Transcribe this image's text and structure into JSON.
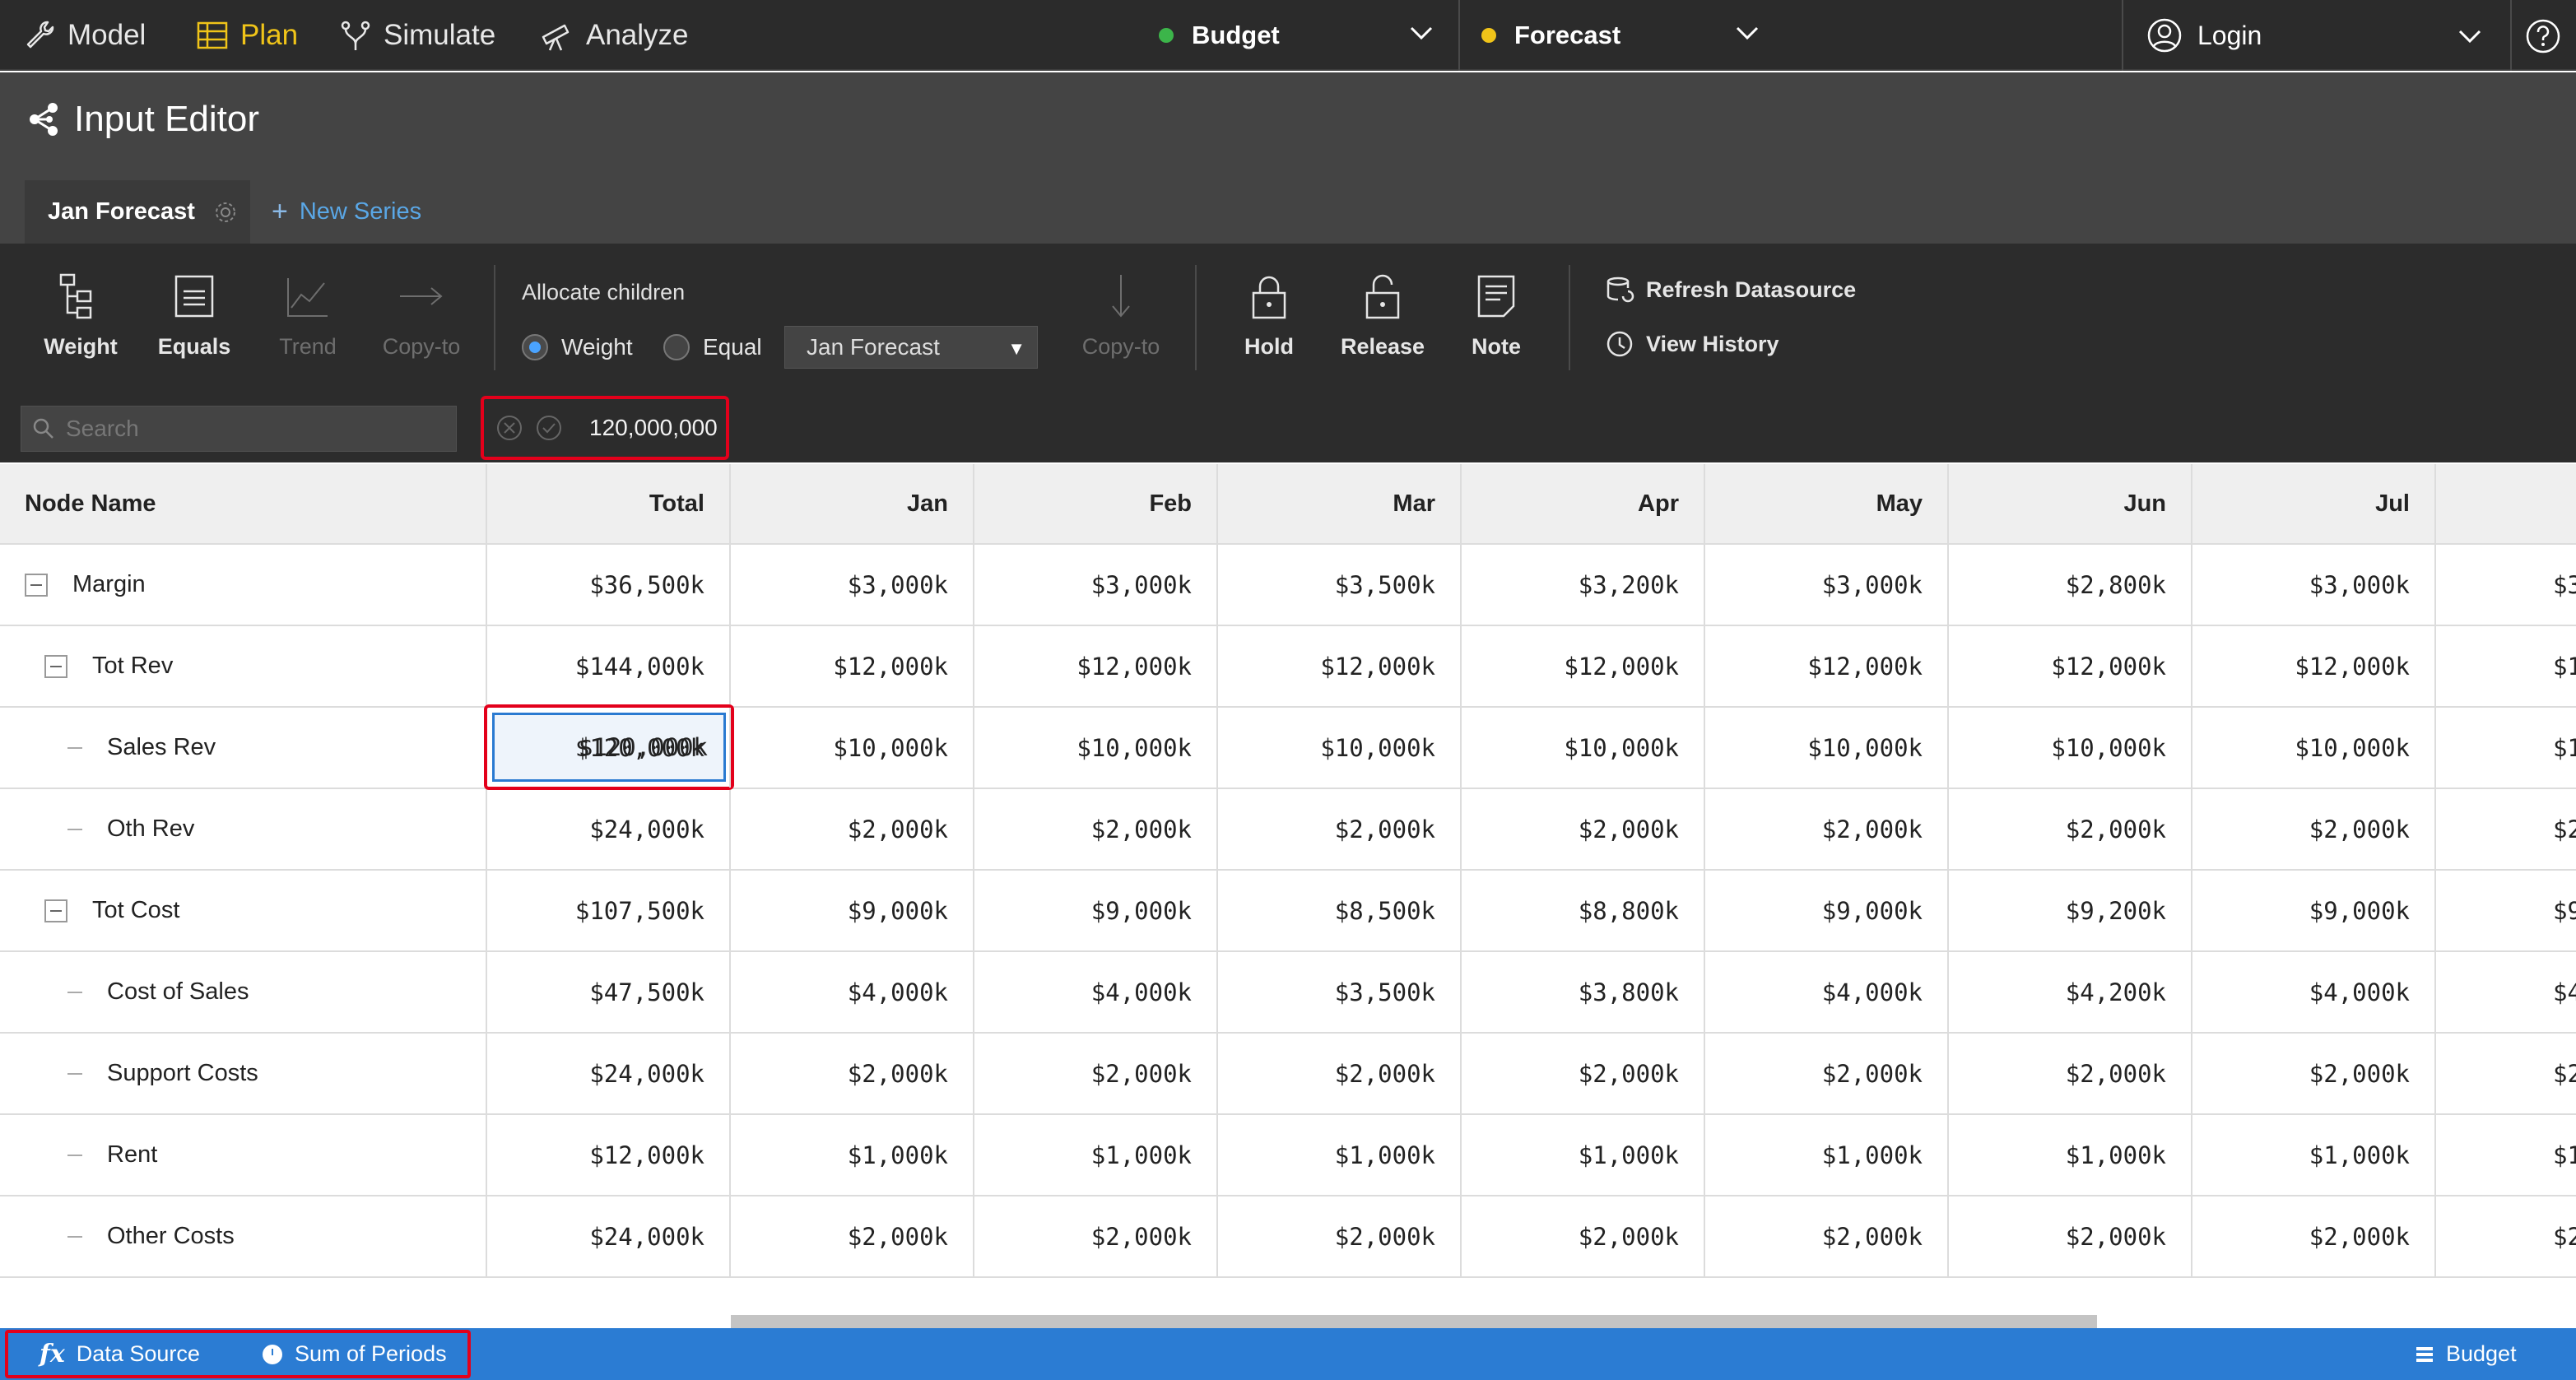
{
  "nav": {
    "items": [
      {
        "label": "Model",
        "icon": "wrench-icon"
      },
      {
        "label": "Plan",
        "icon": "table-icon",
        "active": true
      },
      {
        "label": "Simulate",
        "icon": "fork-icon"
      },
      {
        "label": "Analyze",
        "icon": "telescope-icon"
      }
    ],
    "budget_label": "Budget",
    "budget_color": "#3cb54a",
    "forecast_label": "Forecast",
    "forecast_color": "#f0c419",
    "login_label": "Login",
    "accent_color": "#f0c419"
  },
  "editor": {
    "title": "Input Editor",
    "active_tab": "Jan Forecast",
    "new_tab": "New Series"
  },
  "toolbar": {
    "weight": "Weight",
    "equals": "Equals",
    "trend": "Trend",
    "copy_to": "Copy-to",
    "allocate_label": "Allocate children",
    "radio_weight": "Weight",
    "radio_equal": "Equal",
    "series_select": "Jan Forecast",
    "copy_to_2": "Copy-to",
    "hold": "Hold",
    "release": "Release",
    "note": "Note",
    "refresh": "Refresh Datasource",
    "history": "View History"
  },
  "search": {
    "placeholder": "Search"
  },
  "edit_value": "120,000,000",
  "table": {
    "headers": [
      "Node Name",
      "Total",
      "Jan",
      "Feb",
      "Mar",
      "Apr",
      "May",
      "Jun",
      "Jul"
    ],
    "rows": [
      {
        "name": "Margin",
        "values": [
          "$36,500k",
          "$3,000k",
          "$3,000k",
          "$3,500k",
          "$3,200k",
          "$3,000k",
          "$2,800k",
          "$3,000k",
          "$3"
        ]
      },
      {
        "name": "Tot Rev",
        "values": [
          "$144,000k",
          "$12,000k",
          "$12,000k",
          "$12,000k",
          "$12,000k",
          "$12,000k",
          "$12,000k",
          "$12,000k",
          "$12"
        ]
      },
      {
        "name": "Sales Rev",
        "values": [
          "$120,000k",
          "$10,000k",
          "$10,000k",
          "$10,000k",
          "$10,000k",
          "$10,000k",
          "$10,000k",
          "$10,000k",
          "$10"
        ]
      },
      {
        "name": "Oth Rev",
        "values": [
          "$24,000k",
          "$2,000k",
          "$2,000k",
          "$2,000k",
          "$2,000k",
          "$2,000k",
          "$2,000k",
          "$2,000k",
          "$2"
        ]
      },
      {
        "name": "Tot Cost",
        "values": [
          "$107,500k",
          "$9,000k",
          "$9,000k",
          "$8,500k",
          "$8,800k",
          "$9,000k",
          "$9,200k",
          "$9,000k",
          "$9"
        ]
      },
      {
        "name": "Cost of Sales",
        "values": [
          "$47,500k",
          "$4,000k",
          "$4,000k",
          "$3,500k",
          "$3,800k",
          "$4,000k",
          "$4,200k",
          "$4,000k",
          "$4"
        ]
      },
      {
        "name": "Support Costs",
        "values": [
          "$24,000k",
          "$2,000k",
          "$2,000k",
          "$2,000k",
          "$2,000k",
          "$2,000k",
          "$2,000k",
          "$2,000k",
          "$2"
        ]
      },
      {
        "name": "Rent",
        "values": [
          "$12,000k",
          "$1,000k",
          "$1,000k",
          "$1,000k",
          "$1,000k",
          "$1,000k",
          "$1,000k",
          "$1,000k",
          "$1"
        ]
      },
      {
        "name": "Other Costs",
        "values": [
          "$24,000k",
          "$2,000k",
          "$2,000k",
          "$2,000k",
          "$2,000k",
          "$2,000k",
          "$2,000k",
          "$2,000k",
          "$2"
        ]
      }
    ]
  },
  "status": {
    "data_source": "Data Source",
    "sum_periods": "Sum of Periods",
    "budget": "Budget",
    "bar_color": "#2b7cd3"
  }
}
